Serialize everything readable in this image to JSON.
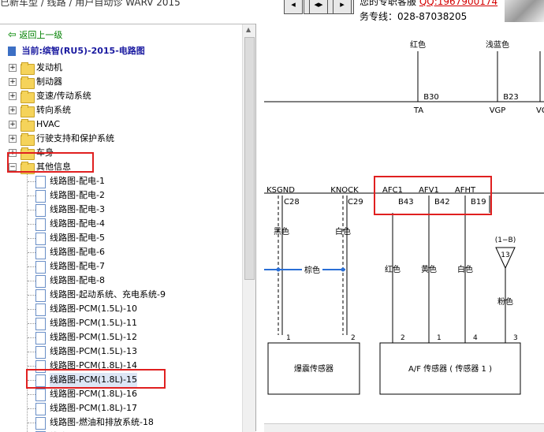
{
  "toolbar": {
    "partial_title": "已新车型 / 线路 / 用户自动诊 WARV 2015",
    "support_label": "您的专职客服",
    "qq": "QQ:1967900174",
    "hotline": "务专线：028-87038205",
    "btn1": "◂",
    "btn2": "◂▸",
    "btn3": "▸"
  },
  "tree": {
    "back": "返回上一级",
    "current": "当前:缤智(RU5)-2015-电路图",
    "folders": [
      "发动机",
      "制动器",
      "变速/传动系统",
      "转向系统",
      "HVAC",
      "行驶支持和保护系统",
      "车身",
      "其他信息"
    ],
    "items": [
      "线路图-配电-1",
      "线路图-配电-2",
      "线路图-配电-3",
      "线路图-配电-4",
      "线路图-配电-5",
      "线路图-配电-6",
      "线路图-配电-7",
      "线路图-配电-8",
      "线路图-起动系统、充电系统-9",
      "线路图-PCM(1.5L)-10",
      "线路图-PCM(1.5L)-11",
      "线路图-PCM(1.5L)-12",
      "线路图-PCM(1.5L)-13",
      "线路图-PCM(1.8L)-14",
      "线路图-PCM(1.8L)-15",
      "线路图-PCM(1.8L)-16",
      "线路图-PCM(1.8L)-17",
      "线路图-燃油和排放系统-18",
      "线路图-..."
    ],
    "selected_index": 14,
    "highlighted_folder": "其他信息"
  },
  "diagram": {
    "top_wires": [
      {
        "color": "红色",
        "pin": "B30",
        "signal": "TA"
      },
      {
        "color": "浅蓝色",
        "pin": "B23",
        "signal": "VGP"
      },
      {
        "color": "",
        "pin": "",
        "signal": "VG"
      }
    ],
    "connector_signals": [
      {
        "signal": "KSGND",
        "pin": "C28",
        "color": "黑色"
      },
      {
        "signal": "KNOCK",
        "pin": "C29",
        "color": "白色"
      },
      {
        "signal": "AFC1",
        "pin": "B43",
        "color": "红色"
      },
      {
        "signal": "AFV1",
        "pin": "B42",
        "color": "黄色"
      },
      {
        "signal": "AFHT",
        "pin": "B19",
        "color": "白色"
      }
    ],
    "shield_color": "棕色",
    "ground_ref": "(1−B)",
    "ground_num": "13",
    "pink_wire": "粉色",
    "knock_sensor": {
      "name": "爆震传感器",
      "pins": [
        "1",
        "2"
      ]
    },
    "af_sensor": {
      "name": "A/F 传感器 ( 传感器 1 )",
      "pins": [
        "2",
        "1",
        "4",
        "3"
      ]
    }
  }
}
